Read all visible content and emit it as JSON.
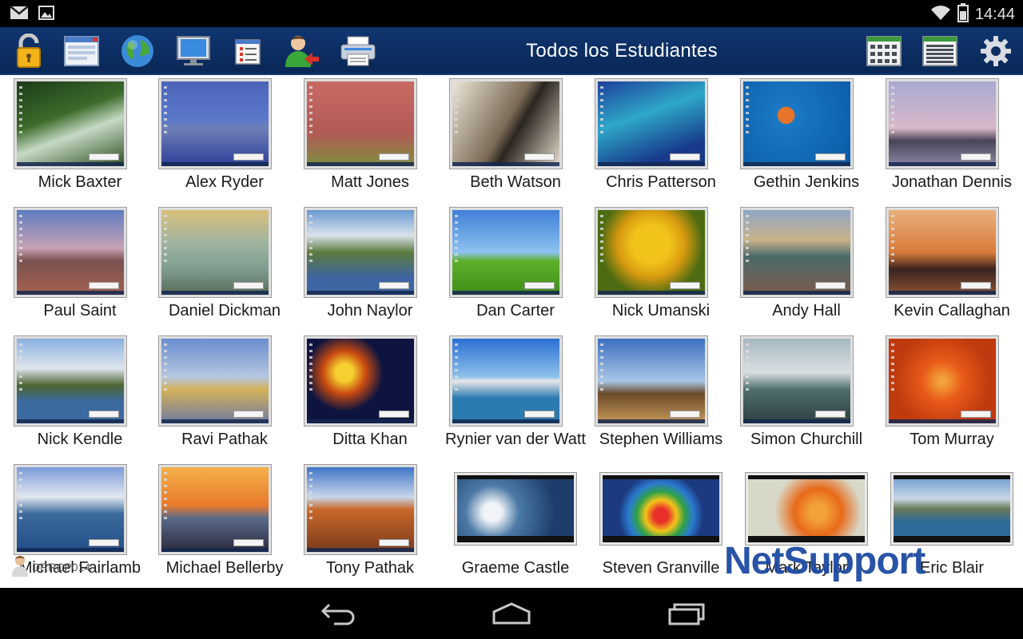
{
  "status": {
    "time": "14:44",
    "icons": [
      "gmail-icon",
      "gallery-icon",
      "wifi-icon",
      "battery-icon"
    ]
  },
  "toolbar": {
    "title": "Todos los Estudiantes",
    "buttons": [
      "lock-icon",
      "window-icon",
      "globe-icon",
      "monitor-icon",
      "checklist-icon",
      "user-remove-icon",
      "printer-icon",
      "grid-view-icon",
      "list-view-icon",
      "settings-gear-icon"
    ]
  },
  "students": [
    {
      "name": "Mick Baxter",
      "bg": "linear-gradient(160deg,#1d3b1a,#3c6b2a 40%,#c6d9c5 60%,#2d4e20)"
    },
    {
      "name": "Alex Ryder",
      "bg": "linear-gradient(#4c64b8,#5b78c9 45%,#6f7fb6 55%,#2e3f9a)"
    },
    {
      "name": "Matt Jones",
      "bg": "linear-gradient(#c86a62,#b25a56 60%,#7f8f3d)"
    },
    {
      "name": "Beth Watson",
      "bg": "linear-gradient(120deg,#ece6d8,#7a6a56 50%,#2b2520 60%,#e4dccb)"
    },
    {
      "name": "Chris Patterson",
      "bg": "linear-gradient(160deg,#1d3f9a,#2ea7c9 40%,#173a8a 80%)"
    },
    {
      "name": "Gethin Jenkins",
      "bg": "radial-gradient(circle at 40% 40%,#e8742a 10%,#1a78c4 11%,#0a5aa6)"
    },
    {
      "name": "Jonathan Dennis",
      "bg": "linear-gradient(#a9a9d2,#d8b8c8 55%,#4a4456 70%,#8d88a6)"
    },
    {
      "name": "Paul Saint",
      "bg": "linear-gradient(#5d7cc0,#c8a2b4 45%,#7a5150 60%,#a4614f)"
    },
    {
      "name": "Daniel Dickman",
      "bg": "linear-gradient(#d8c07a,#9eb4a0 40%,#7d9c8e 70%,#5b6b59)"
    },
    {
      "name": "John Naylor",
      "bg": "linear-gradient(#6a9ad2,#d8e2ea 30%,#5d7a3e 50%,#3d65a2 80%)"
    },
    {
      "name": "Dan Carter",
      "bg": "linear-gradient(#3f7fd8,#8ec2f0 50%,#5eb02a 60%,#3f8e1a)"
    },
    {
      "name": "Nick Umanski",
      "bg": "radial-gradient(circle at 50% 40%,#f2c41a 25%,#d89a10 45%,#4c6b12 70%)"
    },
    {
      "name": "Andy Hall",
      "bg": "linear-gradient(#8fa7c6,#c9b28a 35%,#4c6b6a 55%,#7a5a4a)"
    },
    {
      "name": "Kevin Callaghan",
      "bg": "linear-gradient(#e8b07a,#d87a3a 50%,#3a2420 70%,#8a5234)"
    },
    {
      "name": "Nick Kendle",
      "bg": "linear-gradient(#8ab0e0,#dfe6ee 35%,#4d6632 55%,#3a6aa0 75%)"
    },
    {
      "name": "Ravi Pathak",
      "bg": "linear-gradient(#6a8ed0,#b5c6e0 45%,#d4b25a 60%,#6e7aa0)"
    },
    {
      "name": "Ditta Khan",
      "bg": "radial-gradient(circle at 35% 40%,#f6d030 10%,#c84a10 25%,#0e1440 45%)"
    },
    {
      "name": "Rynier van der Watt",
      "bg": "linear-gradient(#2a6fd4,#8fc0ea 45%,#e8e8e8 50%,#2b7ab0 70%)"
    },
    {
      "name": "Stephen Williams",
      "bg": "linear-gradient(#3c6fc0,#a8c6e6 50%,#6b4a2a 65%,#c89a5a)"
    },
    {
      "name": "Simon Churchill",
      "bg": "linear-gradient(#a6b8c2,#d8dfe2 40%,#4f6e6e 60%,#2e3f42)"
    },
    {
      "name": "Tom Murray",
      "bg": "radial-gradient(circle at 50% 50%,#f2a23a 5%,#e85a18 30%,#c03a10 70%)"
    },
    {
      "name": "Michael Fairlamb",
      "bg": "linear-gradient(#7a9ad8,#e2e8f2 35%,#3b6a9a 55%,#234e8a)"
    },
    {
      "name": "Michael Bellerby",
      "bg": "linear-gradient(#f2b04a,#e87a2a 45%,#5a6a8a 60%,#2a2a3a)"
    },
    {
      "name": "Tony Pathak",
      "bg": "linear-gradient(#3e74c6,#c8d6ea 35%,#c8682a 50%,#7a3a1a)"
    },
    {
      "name": "Graeme Castle",
      "bg": "radial-gradient(circle at 30% 55%,#f0f4f8 10%,#4b7aa6 30%,#1d3e6a 70%)"
    },
    {
      "name": "Steven Granville",
      "bg": "radial-gradient(circle at 50% 60%,#e8302a 10%,#f2c41a 22%,#2ea04a 34%,#2a7ad0 46%,#1c3a80 60%)"
    },
    {
      "name": "Mark Taylor",
      "bg": "radial-gradient(circle at 60% 55%,#f2a23a 10%,#e86a1a 30%,#d8d8c8 55%)"
    },
    {
      "name": "Eric Blair",
      "bg": "linear-gradient(#6a9ad0,#c8d6e6 35%,#6a7a5a 50%,#2e6a9a 70%)"
    }
  ],
  "tablet_indices": [
    24,
    25,
    26,
    27
  ],
  "watermark": {
    "logo": "NetSupport",
    "device_label": "DRRCP014"
  },
  "nav": [
    "back-icon",
    "home-icon",
    "recent-apps-icon"
  ]
}
